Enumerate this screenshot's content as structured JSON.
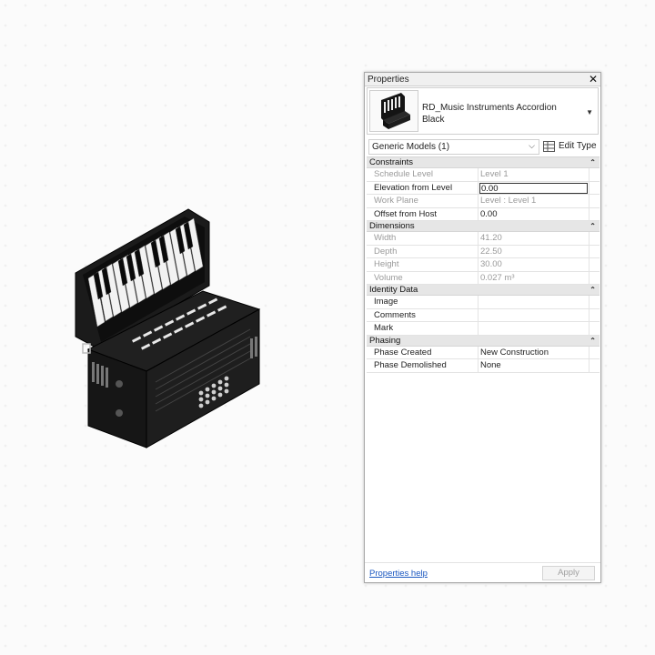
{
  "properties_panel": {
    "title": "Properties",
    "close_glyph": "✕",
    "type_selector": {
      "name_line1": "RD_Music Instruments Accordion",
      "name_line2": "Black",
      "caret_icon": "caret-down-icon"
    },
    "filter": {
      "value": "Generic Models (1)",
      "edit_type_label": "Edit Type"
    },
    "groups": [
      {
        "label": "Constraints",
        "rows": [
          {
            "key": "Schedule Level",
            "value": "Level 1",
            "disabled": true
          },
          {
            "key": "Elevation from Level",
            "value": "0.00",
            "disabled": false,
            "active": true
          },
          {
            "key": "Work Plane",
            "value": "Level : Level 1",
            "disabled": true
          },
          {
            "key": "Offset from Host",
            "value": "0.00",
            "disabled": false
          }
        ]
      },
      {
        "label": "Dimensions",
        "rows": [
          {
            "key": "Width",
            "value": "41.20",
            "disabled": true
          },
          {
            "key": "Depth",
            "value": "22.50",
            "disabled": true
          },
          {
            "key": "Height",
            "value": "30.00",
            "disabled": true
          },
          {
            "key": "Volume",
            "value": "0.027 m³",
            "disabled": true
          }
        ]
      },
      {
        "label": "Identity Data",
        "rows": [
          {
            "key": "Image",
            "value": "",
            "disabled": false
          },
          {
            "key": "Comments",
            "value": "",
            "disabled": false
          },
          {
            "key": "Mark",
            "value": "",
            "disabled": false
          }
        ]
      },
      {
        "label": "Phasing",
        "rows": [
          {
            "key": "Phase Created",
            "value": "New Construction",
            "disabled": false
          },
          {
            "key": "Phase Demolished",
            "value": "None",
            "disabled": false
          }
        ]
      }
    ],
    "footer": {
      "help_link": "Properties help",
      "apply_label": "Apply"
    }
  },
  "colors": {
    "accordion_body": "#151515",
    "keys_white": "#f4f4f4",
    "link": "#1a57c0"
  }
}
